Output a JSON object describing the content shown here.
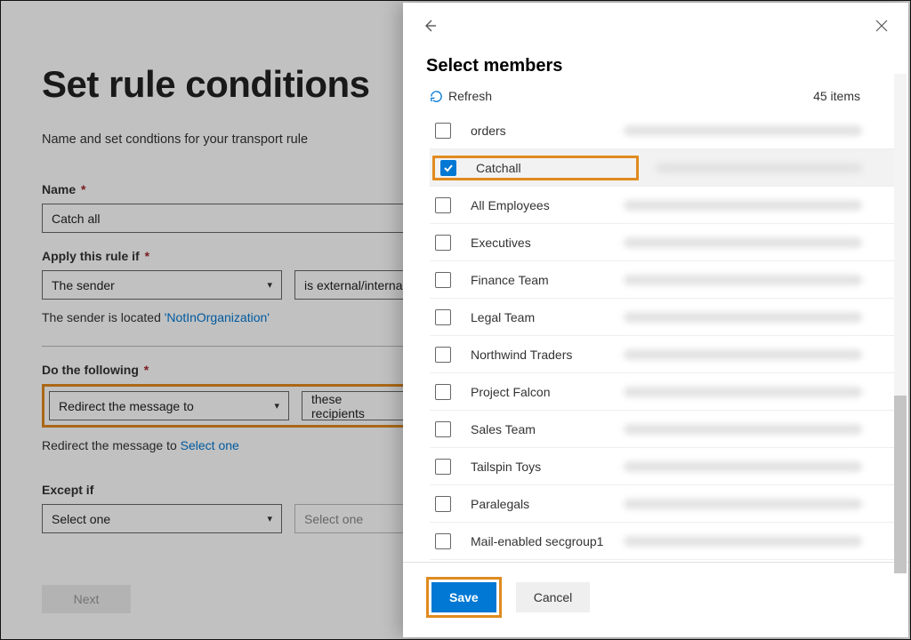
{
  "bg": {
    "title": "Set rule conditions",
    "subtitle": "Name and set condtions for your transport rule",
    "name_label": "Name",
    "name_value": "Catch all",
    "apply_label": "Apply this rule if",
    "apply_dd1": "The sender",
    "apply_dd2": "is external/internal",
    "apply_hint_prefix": "The sender is located ",
    "apply_hint_value": "'NotInOrganization'",
    "do_label": "Do the following",
    "do_dd1": "Redirect the message to",
    "do_dd2": "these recipients",
    "do_hint_prefix": "Redirect the message to ",
    "do_hint_link": "Select one",
    "except_label": "Except if",
    "except_dd1": "Select one",
    "except_dd2": "Select one",
    "next": "Next"
  },
  "panel": {
    "title": "Select members",
    "refresh": "Refresh",
    "count": "45 items",
    "save": "Save",
    "cancel": "Cancel",
    "items": [
      {
        "name": "orders",
        "checked": false
      },
      {
        "name": "Catchall",
        "checked": true
      },
      {
        "name": "All Employees",
        "checked": false
      },
      {
        "name": "Executives",
        "checked": false
      },
      {
        "name": "Finance Team",
        "checked": false
      },
      {
        "name": "Legal Team",
        "checked": false
      },
      {
        "name": "Northwind Traders",
        "checked": false
      },
      {
        "name": "Project Falcon",
        "checked": false
      },
      {
        "name": "Sales Team",
        "checked": false
      },
      {
        "name": "Tailspin Toys",
        "checked": false
      },
      {
        "name": "Paralegals",
        "checked": false
      },
      {
        "name": "Mail-enabled secgroup1",
        "checked": false
      }
    ]
  }
}
